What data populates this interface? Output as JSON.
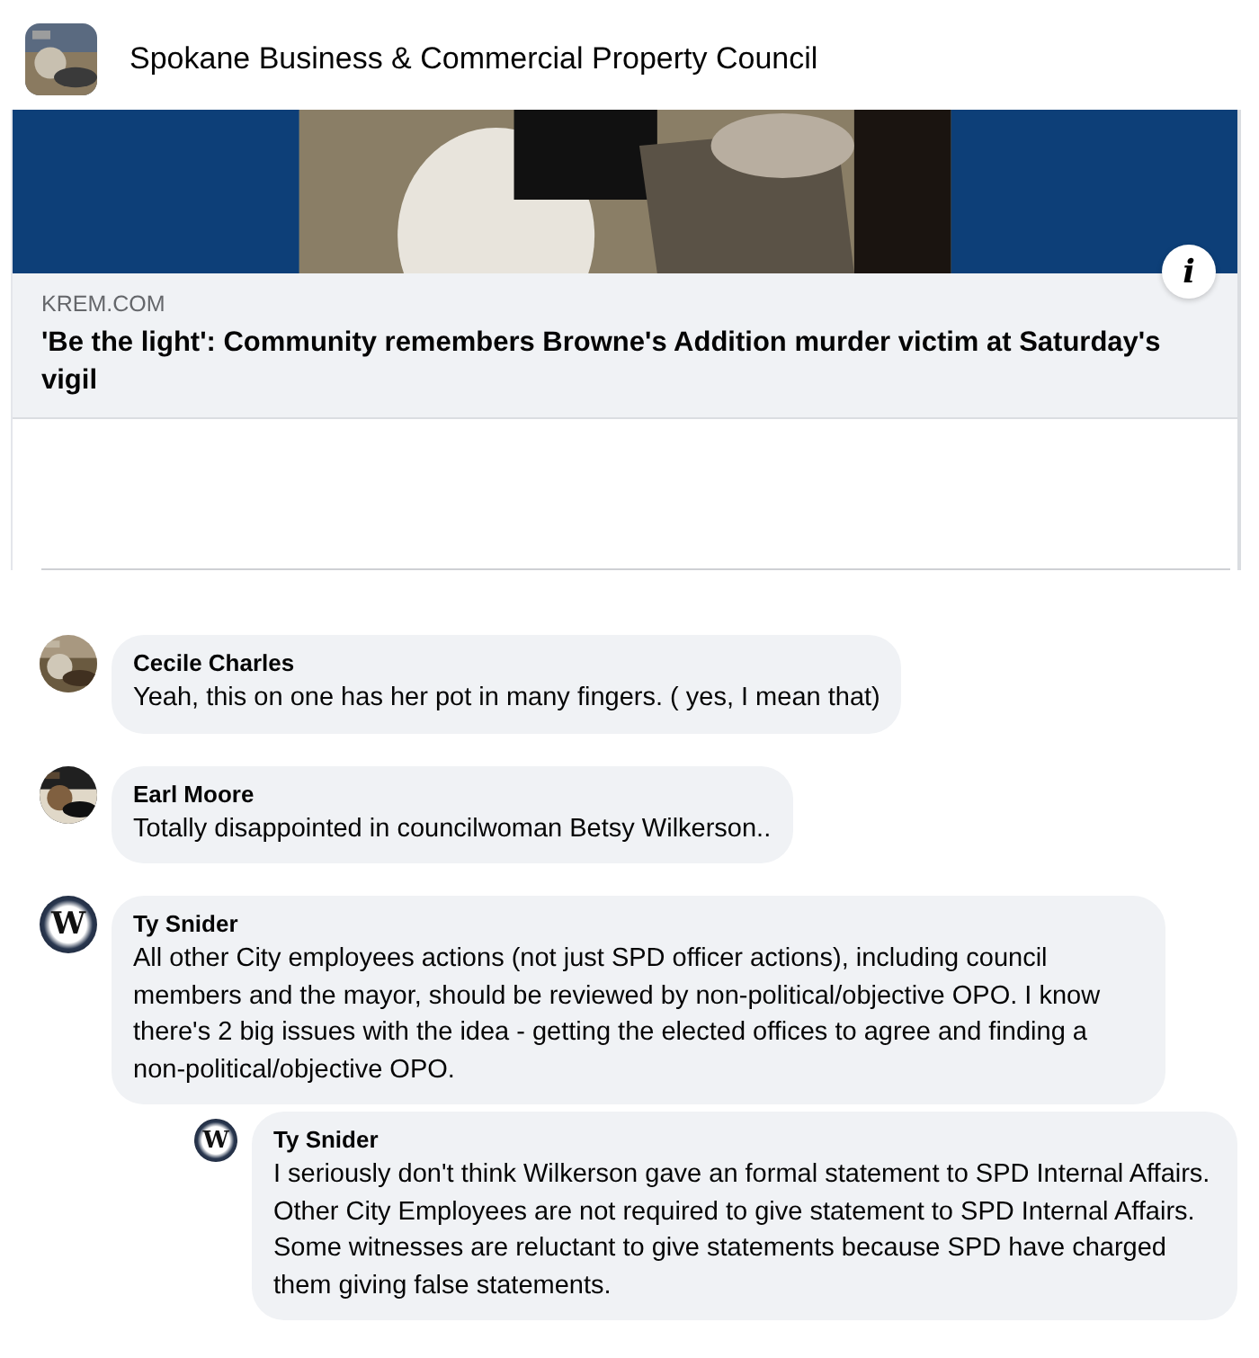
{
  "group": {
    "name": "Spokane Business & Commercial Property Council"
  },
  "link_preview": {
    "info_button": "i",
    "source": "KREM.COM",
    "headline": "'Be the light': Community remembers Browne's Addition murder victim at Saturday's vigil"
  },
  "comments": [
    {
      "author": "Cecile Charles",
      "text": "Yeah, this on one has her pot in many fingers. ( yes, I mean that)"
    },
    {
      "author": "Earl Moore",
      "text": "Totally disappointed in councilwoman Betsy Wilkerson.."
    },
    {
      "author": "Ty Snider",
      "avatar": {
        "kind": "letter",
        "letter": "W"
      },
      "text": "All other City employees actions (not just SPD officer actions), including council members and the mayor, should be reviewed by non-political/objective OPO. I know there's 2 big issues with the idea - getting the elected offices to agree and finding a non-political/objective OPO.",
      "children": [
        {
          "author": "Ty Snider",
          "avatar": {
            "kind": "letter",
            "letter": "W"
          },
          "text": "I seriously don't think Wilkerson gave an formal statement to SPD Internal Affairs. Other City Employees are not required to give statement to SPD Internal Affairs. Some witnesses are reluctant to give statements because SPD have charged them giving false statements."
        }
      ]
    }
  ]
}
